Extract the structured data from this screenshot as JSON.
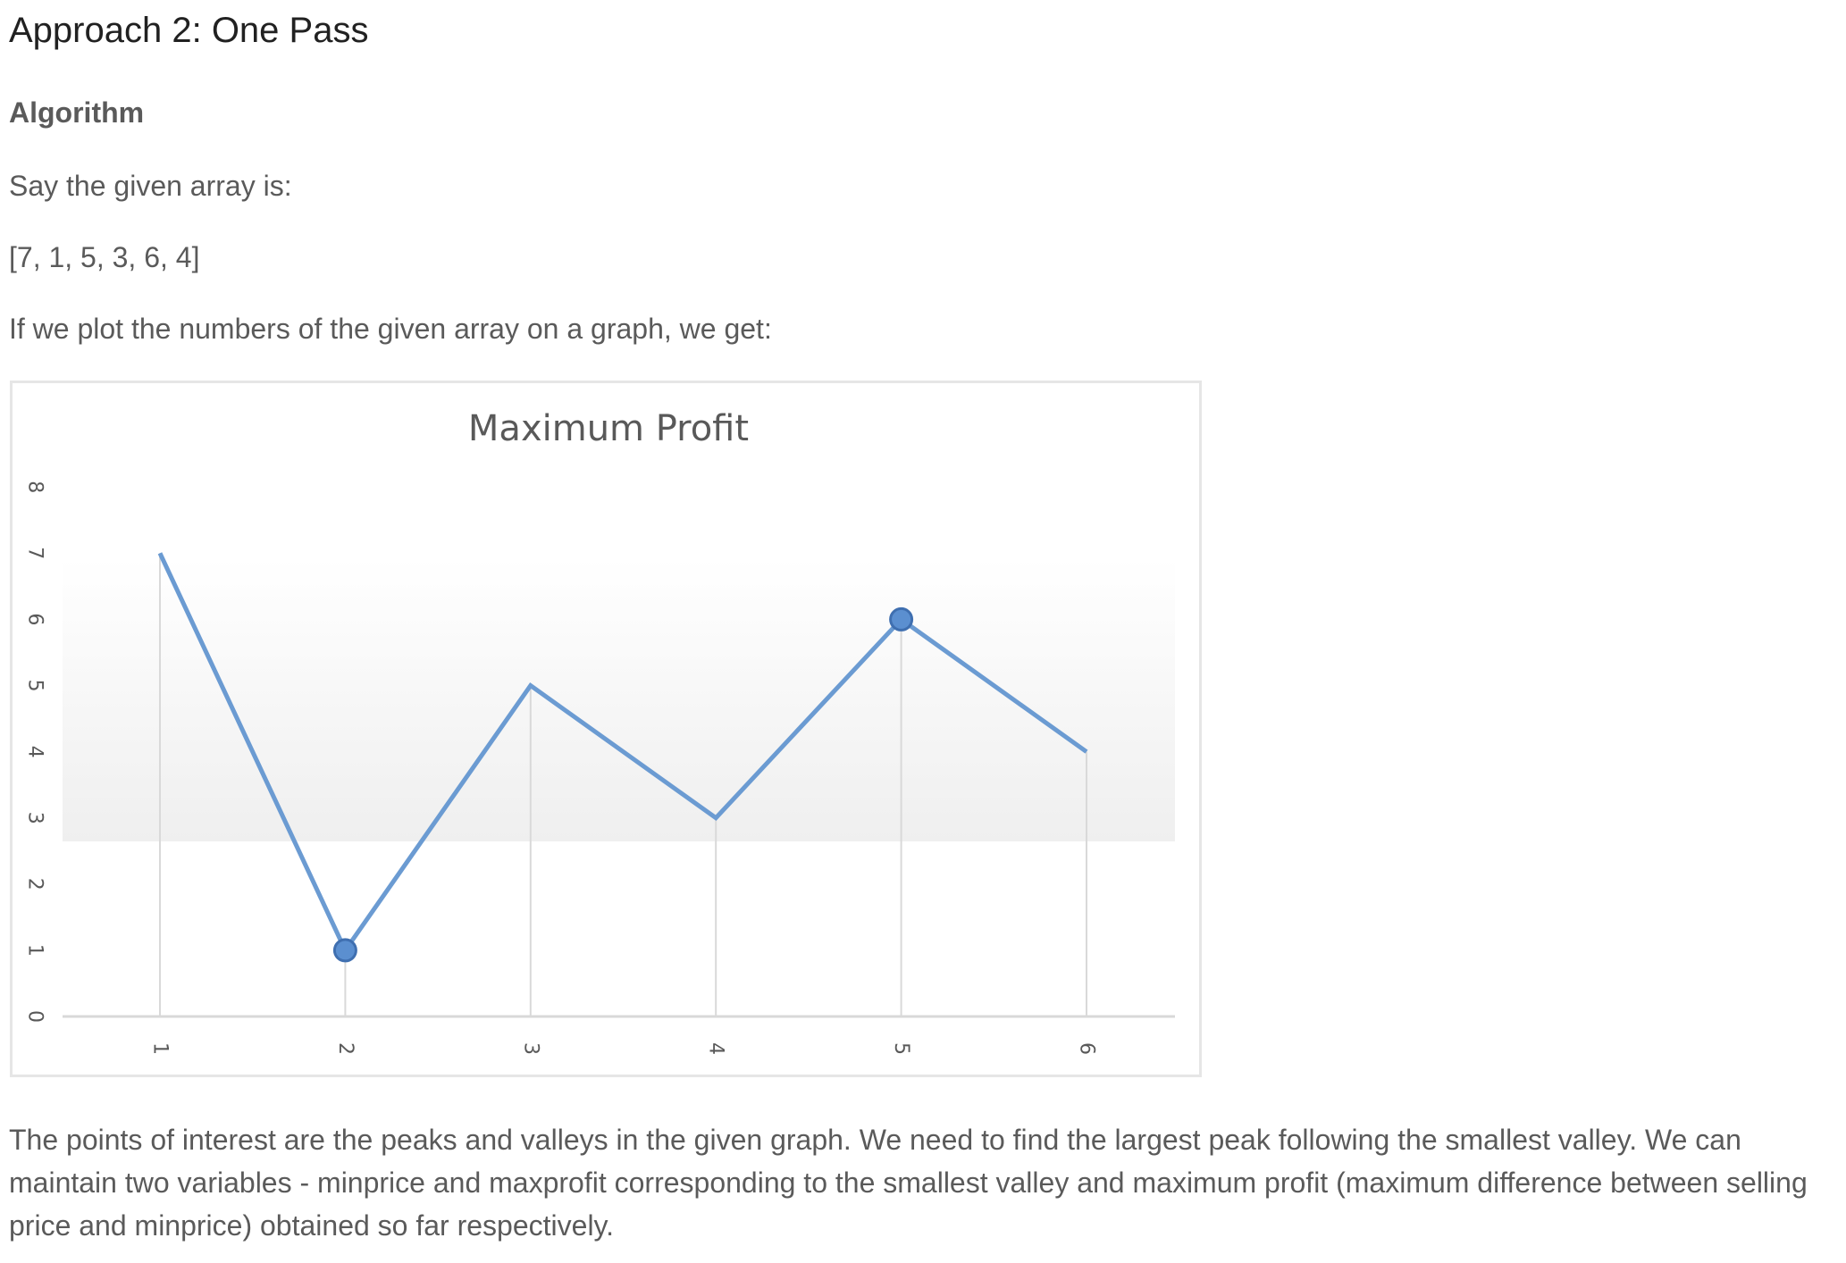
{
  "heading": "Approach 2: One Pass",
  "subheading": "Algorithm",
  "paragraphs": {
    "intro": "Say the given array is:",
    "array": "[7, 1, 5, 3, 6, 4]",
    "plot_intro": "If we plot the numbers of the given array on a graph, we get:"
  },
  "bottom_text": "The points of interest are the peaks and valleys in the given graph. We need to find the largest peak following the smallest valley. We can maintain two variables - minprice and maxprofit corresponding to the smallest valley and maximum profit (maximum difference between selling price and minprice) obtained so far respectively.",
  "colors": {
    "line": "#6b9bd2",
    "marker_fill": "#5b8fd0",
    "marker_stroke": "#3f6fb0",
    "text": "#5a5a5a",
    "grid": "#d9d9d9"
  },
  "chart_data": {
    "type": "line",
    "title": "Maximum Profit",
    "x": [
      1,
      2,
      3,
      4,
      5,
      6
    ],
    "y": [
      7,
      1,
      5,
      3,
      6,
      4
    ],
    "xlabel": "",
    "ylabel": "",
    "ylim": [
      0,
      8
    ],
    "yticks": [
      0,
      1,
      2,
      3,
      4,
      5,
      6,
      7,
      8
    ],
    "xticks": [
      1,
      2,
      3,
      4,
      5,
      6
    ],
    "highlighted_points": [
      {
        "x": 2,
        "y": 1
      },
      {
        "x": 5,
        "y": 6
      }
    ],
    "grid": "vertical drop lines",
    "legend": "none"
  }
}
